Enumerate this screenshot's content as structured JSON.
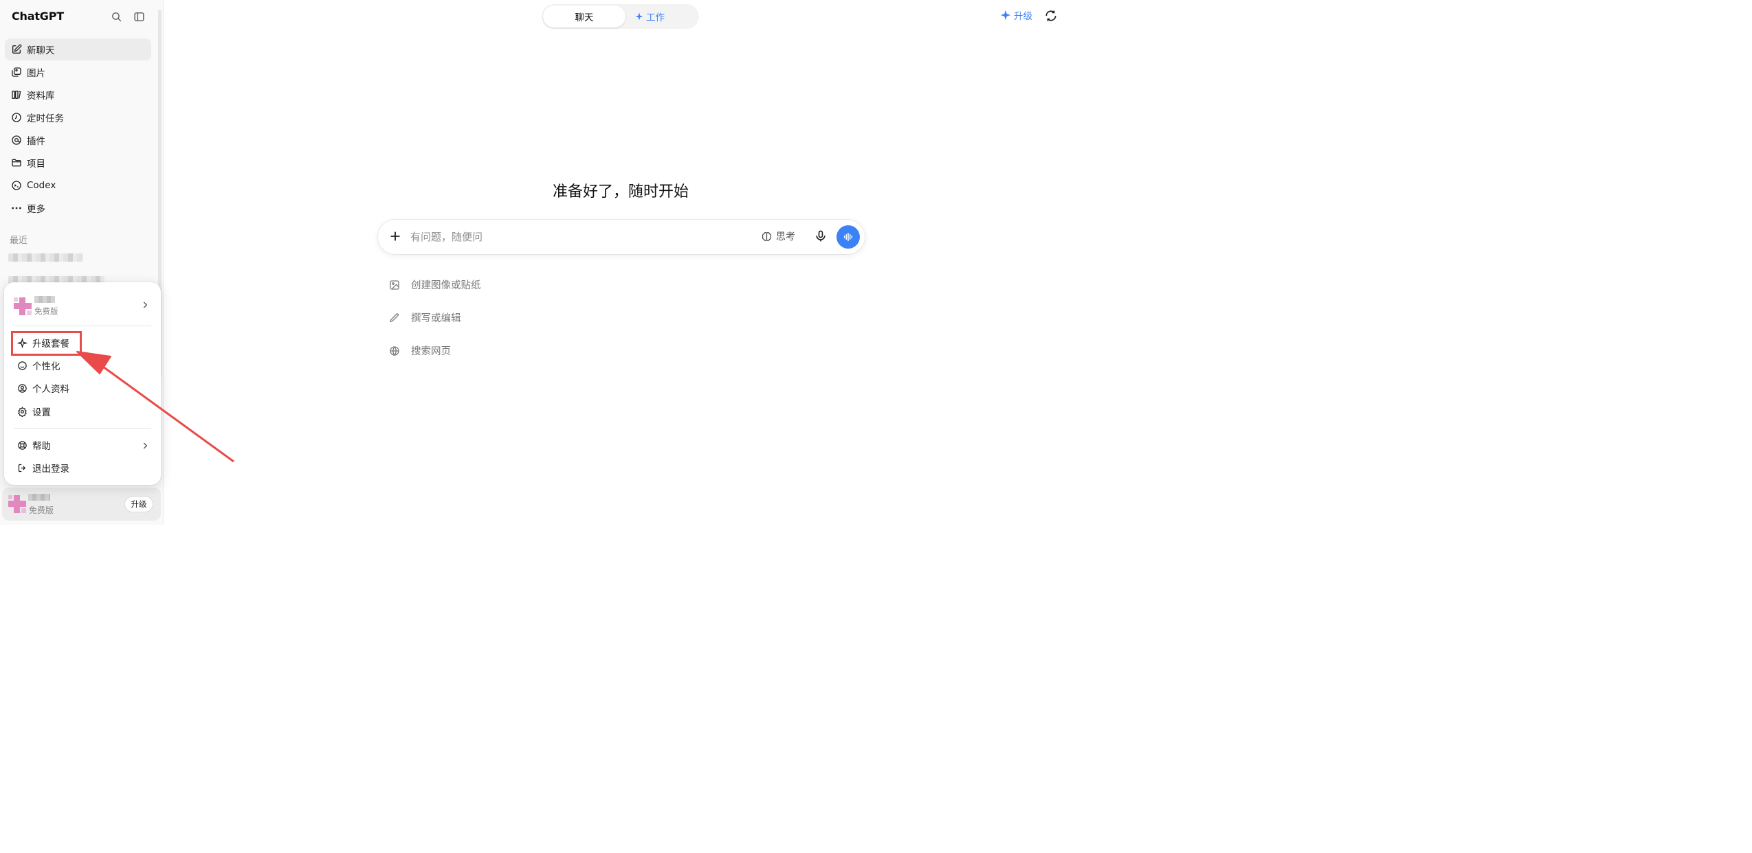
{
  "app": {
    "title": "ChatGPT"
  },
  "sidebar": {
    "items": [
      {
        "label": "新聊天",
        "icon": "new-chat-icon"
      },
      {
        "label": "图片",
        "icon": "images-icon"
      },
      {
        "label": "资料库",
        "icon": "library-icon"
      },
      {
        "label": "定时任务",
        "icon": "clock-icon"
      },
      {
        "label": "插件",
        "icon": "plugin-icon"
      },
      {
        "label": "项目",
        "icon": "folder-icon"
      },
      {
        "label": "Codex",
        "icon": "codex-icon"
      },
      {
        "label": "更多",
        "icon": "more-dots-icon"
      }
    ],
    "recent_label": "最近"
  },
  "account_menu": {
    "plan": "免费版",
    "items": {
      "upgrade": "升级套餐",
      "personalize": "个性化",
      "profile": "个人资料",
      "settings": "设置",
      "help": "帮助",
      "logout": "退出登录"
    }
  },
  "user_bar": {
    "plan": "免费版",
    "upgrade_button": "升级"
  },
  "header": {
    "mode_chat": "聊天",
    "mode_work": "工作",
    "upgrade": "升级"
  },
  "main": {
    "heading": "准备好了，随时开始",
    "composer": {
      "placeholder": "有问题，随便问",
      "think_label": "思考"
    },
    "suggestions": [
      {
        "label": "创建图像或贴纸",
        "icon": "image-icon"
      },
      {
        "label": "撰写或编辑",
        "icon": "pencil-icon"
      },
      {
        "label": "搜索网页",
        "icon": "globe-icon"
      }
    ]
  },
  "colors": {
    "accent": "#3b82f6",
    "annotation": "#e94a4a",
    "sidebar_bg": "#f9f9f9",
    "active_item_bg": "#ececec"
  }
}
